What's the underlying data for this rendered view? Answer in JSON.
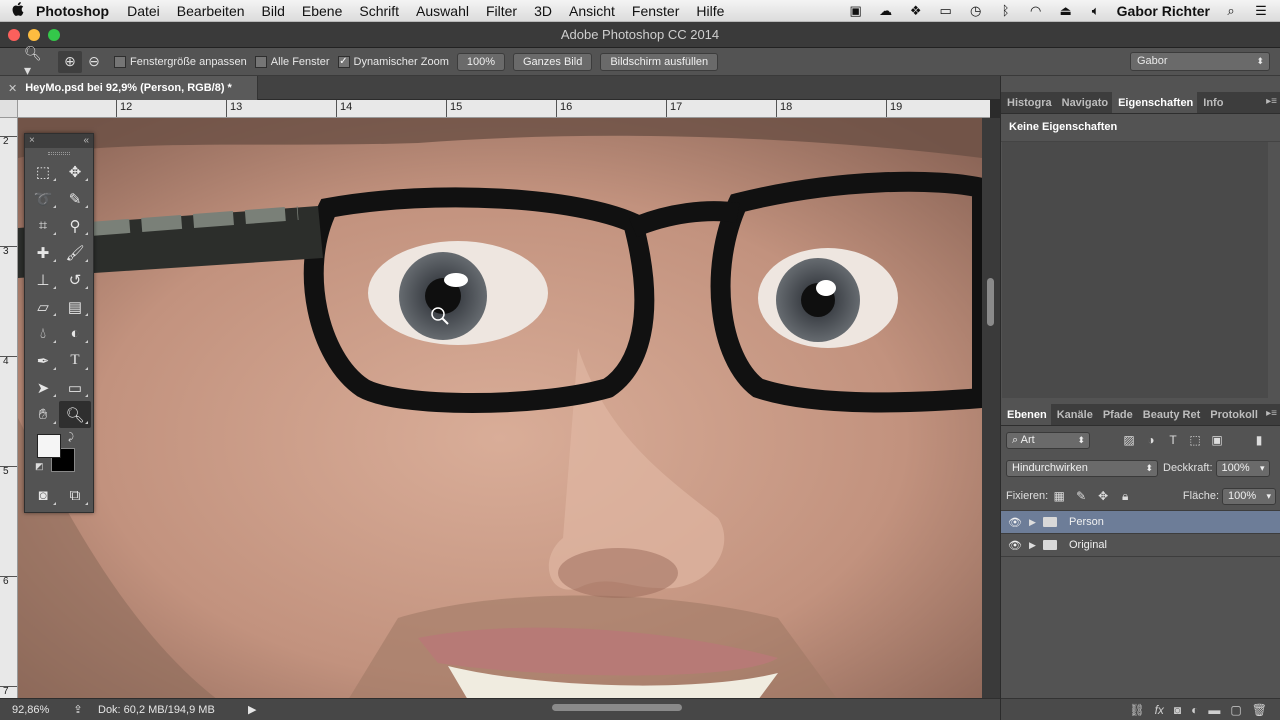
{
  "menubar": {
    "apple": "",
    "app": "Photoshop",
    "items": [
      "Datei",
      "Bearbeiten",
      "Bild",
      "Ebene",
      "Schrift",
      "Auswahl",
      "Filter",
      "3D",
      "Ansicht",
      "Fenster",
      "Hilfe"
    ],
    "user": "Gabor Richter"
  },
  "window": {
    "title": "Adobe Photoshop CC 2014"
  },
  "options": {
    "resize_window": "Fenstergröße anpassen",
    "all_windows": "Alle Fenster",
    "dynamic_zoom": "Dynamischer Zoom",
    "dynamic_zoom_checked": true,
    "zoom_100": "100%",
    "fit_screen": "Ganzes Bild",
    "fill_screen": "Bildschirm ausfüllen",
    "workspace": "Gabor"
  },
  "document": {
    "tab": "HeyMo.psd bei 92,9% (Person, RGB/8) *"
  },
  "ruler": {
    "h": [
      "12",
      "13",
      "14",
      "15",
      "16",
      "17",
      "18",
      "19"
    ],
    "v": [
      "2",
      "3",
      "4",
      "5",
      "6",
      "7"
    ]
  },
  "properties": {
    "tabs": [
      "Histogra",
      "Navigato",
      "Eigenschaften",
      "Info"
    ],
    "active": "Eigenschaften",
    "content": "Keine Eigenschaften"
  },
  "layers": {
    "tabs": [
      "Ebenen",
      "Kanäle",
      "Pfade",
      "Beauty Ret",
      "Protokoll"
    ],
    "filter": "Art",
    "blend": "Hindurchwirken",
    "opacity_label": "Deckkraft:",
    "opacity": "100%",
    "lock_label": "Fixieren:",
    "fill_label": "Fläche:",
    "fill": "100%",
    "items": [
      {
        "name": "Person",
        "selected": true
      },
      {
        "name": "Original",
        "selected": false
      }
    ]
  },
  "status": {
    "zoom": "92,86%",
    "doc": "Dok: 60,2 MB/194,9 MB"
  },
  "colors": {
    "foreground": "#f5f5f5",
    "background": "#000000",
    "selection": "#6d7d98"
  }
}
